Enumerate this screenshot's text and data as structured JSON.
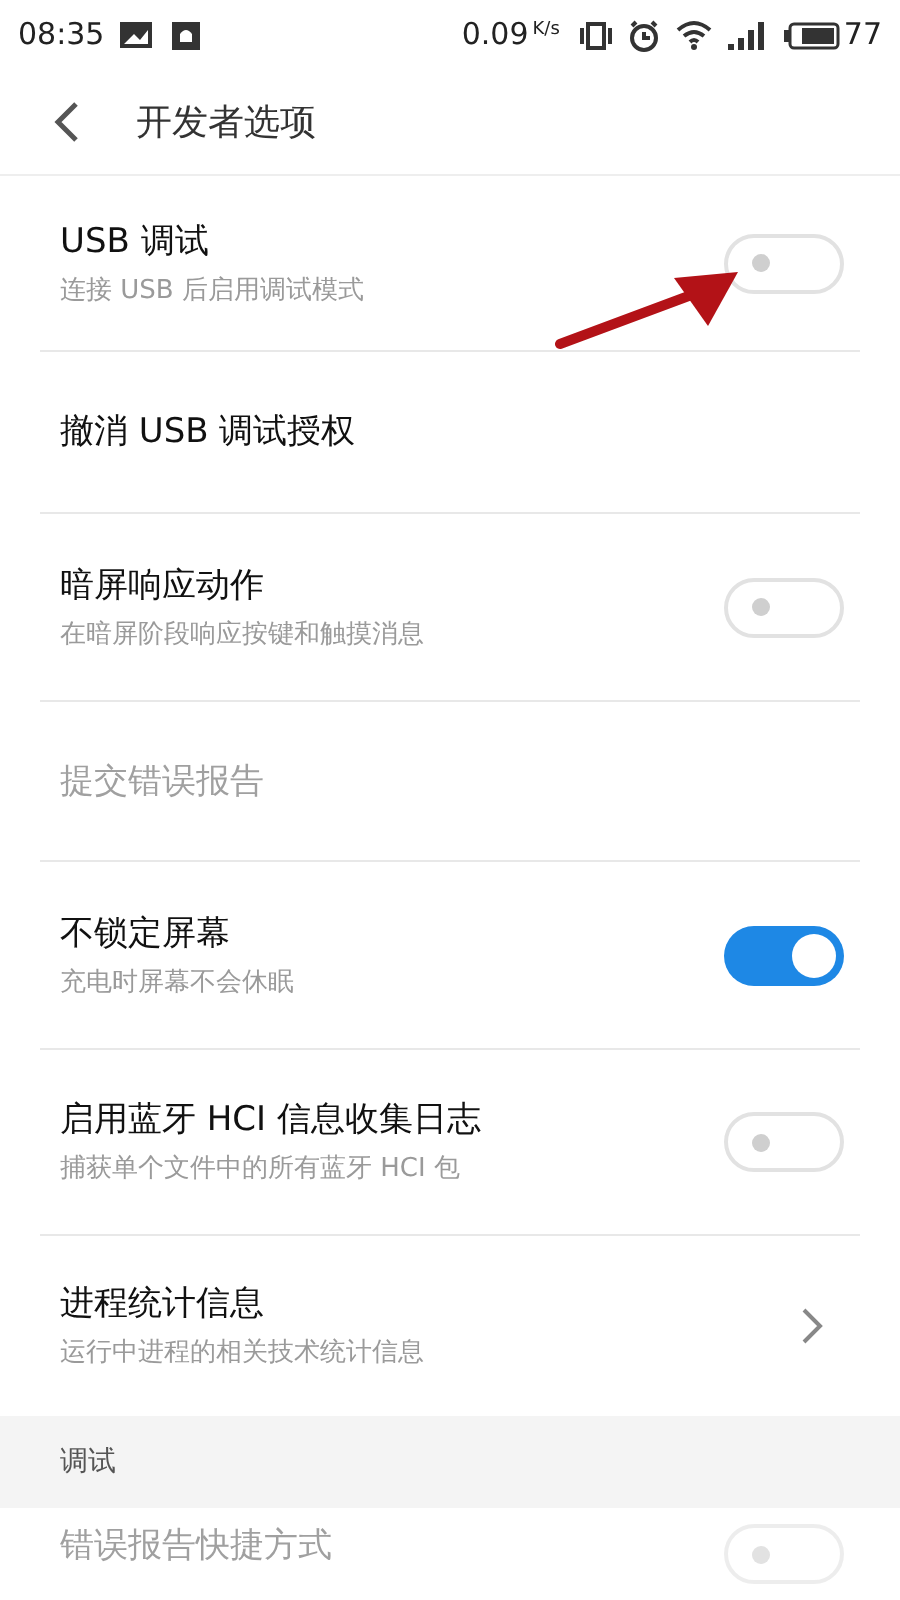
{
  "status_bar": {
    "time": "08:35",
    "speed": "0.09",
    "speed_unit": "K/s",
    "battery": "77"
  },
  "header": {
    "title": "开发者选项"
  },
  "items": [
    {
      "kind": "toggle",
      "title": "USB 调试",
      "subtitle": "连接 USB 后启用调试模式",
      "on": false,
      "disabled": false
    },
    {
      "kind": "plain",
      "title": "撤消 USB 调试授权",
      "disabled": false
    },
    {
      "kind": "toggle",
      "title": "暗屏响应动作",
      "subtitle": "在暗屏阶段响应按键和触摸消息",
      "on": false,
      "disabled": false
    },
    {
      "kind": "plain",
      "title": "提交错误报告",
      "disabled": true
    },
    {
      "kind": "toggle",
      "title": "不锁定屏幕",
      "subtitle": "充电时屏幕不会休眠",
      "on": true,
      "disabled": false
    },
    {
      "kind": "toggle",
      "title": "启用蓝牙 HCI 信息收集日志",
      "subtitle": "捕获单个文件中的所有蓝牙 HCI 包",
      "on": false,
      "disabled": false
    },
    {
      "kind": "chevron",
      "title": "进程统计信息",
      "subtitle": "运行中进程的相关技术统计信息",
      "disabled": false
    }
  ],
  "section": {
    "title": "调试"
  },
  "section_items": [
    {
      "kind": "toggle",
      "title": "错误报告快捷方式",
      "on": false,
      "disabled": true
    }
  ]
}
